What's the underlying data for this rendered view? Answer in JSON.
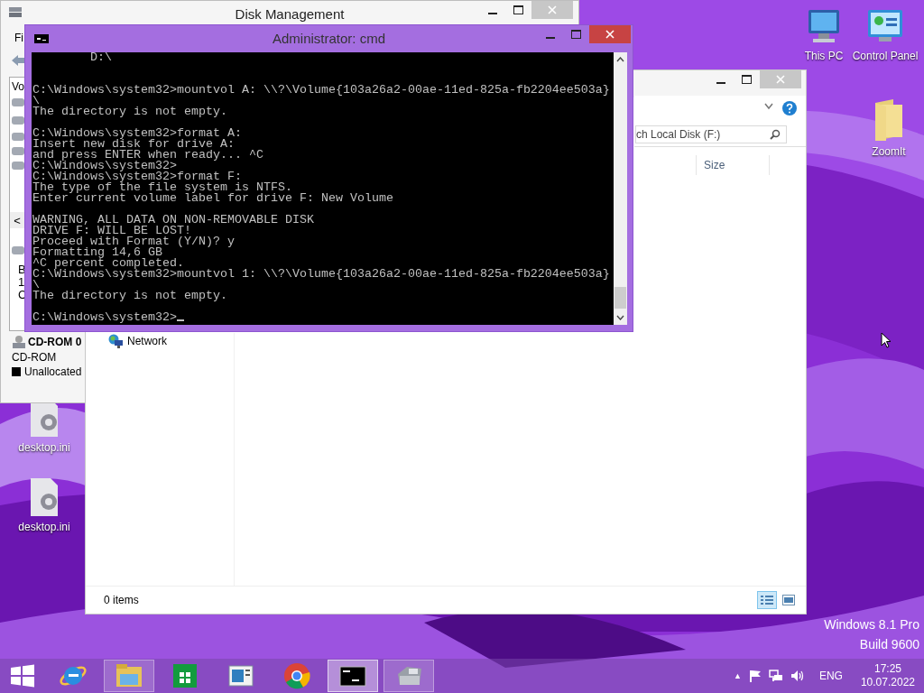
{
  "desktop_icons": [
    {
      "kind": "computer",
      "label": "This PC"
    },
    {
      "kind": "control-panel",
      "label": "Control Panel"
    },
    {
      "kind": "folder",
      "label": "ZoomIt"
    },
    {
      "kind": "file",
      "label": "desktop.ini"
    },
    {
      "kind": "file",
      "label": "desktop.ini"
    }
  ],
  "os_text": [
    "Windows 8.1 Pro",
    "Build 9600"
  ],
  "disk_management": {
    "title": "Disk Management",
    "menu_fragment": "Fi",
    "column_fragment": "Vo",
    "scroll_left": "<",
    "row_fragments": [
      "B",
      "1",
      "C"
    ],
    "cdrom_name": "CD-ROM 0",
    "cdrom_type": "CD-ROM",
    "legend": "Unallocated"
  },
  "explorer": {
    "search_placeholder": "ch Local Disk (F:)",
    "column": "Size",
    "nav_item": "Network",
    "status": "0 items",
    "views": [
      {
        "kind": "details",
        "selected": true
      },
      {
        "kind": "large-icons",
        "selected": false
      }
    ]
  },
  "cmd": {
    "title": "Administrator: cmd",
    "console": "        D:\\\n\n\nC:\\Windows\\system32>mountvol A: \\\\?\\Volume{103a26a2-00ae-11ed-825a-fb2204ee503a}\n\\\nThe directory is not empty.\n\nC:\\Windows\\system32>format A:\nInsert new disk for drive A:\nand press ENTER when ready... ^C\nC:\\Windows\\system32>\nC:\\Windows\\system32>format F:\nThe type of the file system is NTFS.\nEnter current volume label for drive F: New Volume\n\nWARNING, ALL DATA ON NON-REMOVABLE DISK\nDRIVE F: WILL BE LOST!\nProceed with Format (Y/N)? y\nFormatting 14,6 GB\n^C percent completed.\nC:\\Windows\\system32>mountvol 1: \\\\?\\Volume{103a26a2-00ae-11ed-825a-fb2204ee503a}\n\\\nThe directory is not empty.\n\nC:\\Windows\\system32>"
  },
  "taskbar": {
    "apps": [
      {
        "kind": "ie",
        "running": false,
        "active": false
      },
      {
        "kind": "explorer",
        "running": true,
        "active": false
      },
      {
        "kind": "store",
        "running": false,
        "active": false
      },
      {
        "kind": "reader",
        "running": false,
        "active": false
      },
      {
        "kind": "chrome",
        "running": false,
        "active": false
      },
      {
        "kind": "cmd",
        "running": true,
        "active": true
      },
      {
        "kind": "diskmgmt",
        "running": true,
        "active": false
      }
    ],
    "tray_expand": "▲",
    "language": "ENG",
    "time": "17:25",
    "date": "10.07.2022"
  }
}
